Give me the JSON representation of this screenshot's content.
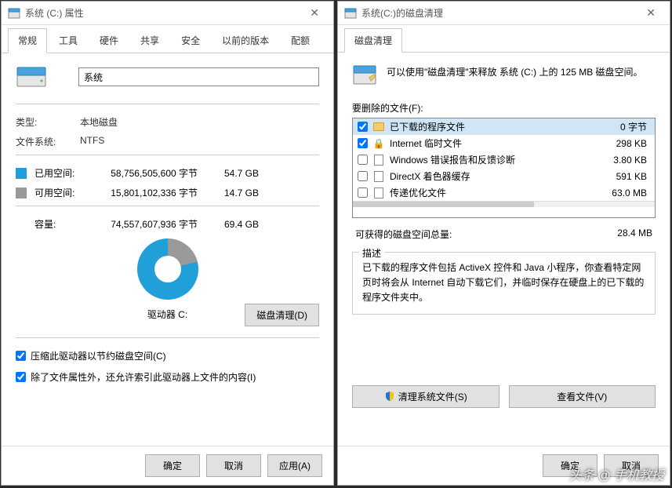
{
  "left": {
    "title": "系统 (C:) 属性",
    "tabs": [
      "常规",
      "工具",
      "硬件",
      "共享",
      "安全",
      "以前的版本",
      "配额"
    ],
    "activeTab": 0,
    "volumeLabel": "系统",
    "type": {
      "label": "类型:",
      "value": "本地磁盘"
    },
    "fs": {
      "label": "文件系统:",
      "value": "NTFS"
    },
    "used": {
      "label": "已用空间:",
      "bytes": "58,756,505,600 字节",
      "gb": "54.7 GB"
    },
    "free": {
      "label": "可用空间:",
      "bytes": "15,801,102,336 字节",
      "gb": "14.7 GB"
    },
    "capacity": {
      "label": "容量:",
      "bytes": "74,557,607,936 字节",
      "gb": "69.4 GB"
    },
    "driveCaption": "驱动器 C:",
    "cleanupBtn": "磁盘清理(D)",
    "compress": "压缩此驱动器以节约磁盘空间(C)",
    "indexing": "除了文件属性外，还允许索引此驱动器上文件的内容(I)",
    "footer": {
      "ok": "确定",
      "cancel": "取消",
      "apply": "应用(A)"
    }
  },
  "right": {
    "title": "系统(C:)的磁盘清理",
    "tab": "磁盘清理",
    "intro": "可以使用\"磁盘清理\"来释放 系统 (C:) 上的 125 MB 磁盘空间。",
    "filesLabel": "要删除的文件(F):",
    "items": [
      {
        "checked": true,
        "icon": "folder",
        "name": "已下载的程序文件",
        "size": "0 字节",
        "selected": true
      },
      {
        "checked": true,
        "icon": "lock",
        "name": "Internet 临时文件",
        "size": "298 KB",
        "selected": false
      },
      {
        "checked": false,
        "icon": "file",
        "name": "Windows 错误报告和反馈诊断",
        "size": "3.80 KB",
        "selected": false
      },
      {
        "checked": false,
        "icon": "file",
        "name": "DirectX 着色器缓存",
        "size": "591 KB",
        "selected": false
      },
      {
        "checked": false,
        "icon": "file",
        "name": "传递优化文件",
        "size": "63.0 MB",
        "selected": false
      }
    ],
    "gain": {
      "label": "可获得的磁盘空间总量:",
      "value": "28.4 MB"
    },
    "descLegend": "描述",
    "descText": "已下载的程序文件包括 ActiveX 控件和 Java 小程序，你查看特定网页时将会从 Internet 自动下载它们，并临时保存在硬盘上的已下载的程序文件夹中。",
    "cleanSystem": "清理系统文件(S)",
    "viewFiles": "查看文件(V)",
    "footer": {
      "ok": "确定",
      "cancel": "取消"
    }
  },
  "watermark": "头条 @ 手机教授"
}
